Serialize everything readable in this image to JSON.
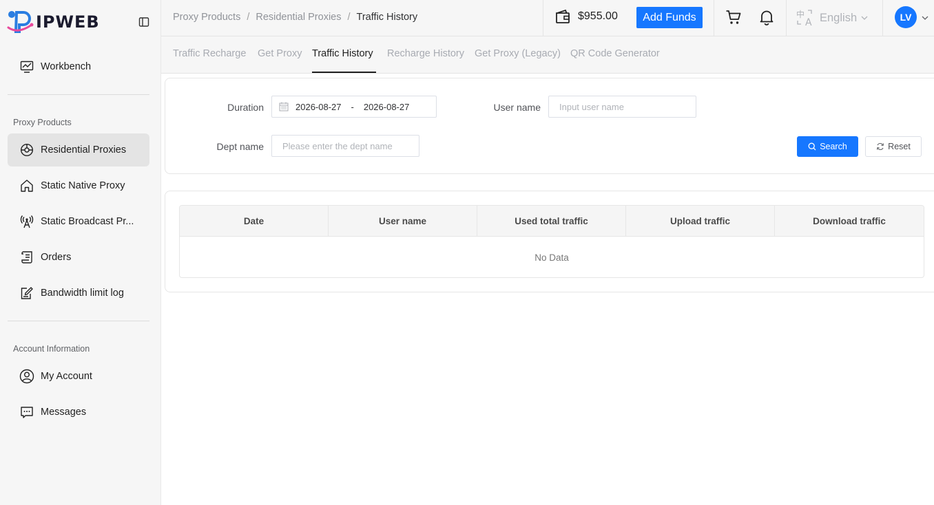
{
  "brand": {
    "name": "IPWEB",
    "primary_color": "#1677ff"
  },
  "sidebar": {
    "workbench": {
      "label": "Workbench",
      "icon": "monitor-chart-icon"
    },
    "groups": [
      {
        "title": "Proxy Products",
        "items": [
          {
            "label": "Residential Proxies",
            "icon": "globe-icon",
            "active": true
          },
          {
            "label": "Static Native Proxy",
            "icon": "home-icon",
            "active": false
          },
          {
            "label": "Static Broadcast Pr...",
            "icon": "antenna-icon",
            "active": false
          },
          {
            "label": "Orders",
            "icon": "scroll-icon",
            "active": false
          },
          {
            "label": "Bandwidth limit log",
            "icon": "edit-note-icon",
            "active": false
          }
        ]
      },
      {
        "title": "Account Information",
        "items": [
          {
            "label": "My Account",
            "icon": "user-circle-icon",
            "active": false
          },
          {
            "label": "Messages",
            "icon": "chat-bubble-icon",
            "active": false
          }
        ]
      }
    ]
  },
  "header": {
    "breadcrumb": [
      "Proxy Products",
      "Residential Proxies",
      "Traffic History"
    ],
    "balance": "$955.00",
    "add_funds_label": "Add Funds",
    "language": "English",
    "avatar_initials": "LV"
  },
  "tabs": [
    {
      "label": "Traffic Recharge",
      "active": false
    },
    {
      "label": "Get Proxy",
      "active": false
    },
    {
      "label": "Traffic History",
      "active": true
    },
    {
      "label": "Recharge History",
      "active": false
    },
    {
      "label": "Get Proxy (Legacy)",
      "active": false
    },
    {
      "label": "QR Code Generator",
      "active": false
    }
  ],
  "filters": {
    "duration_label": "Duration",
    "date_start": "2026-08-27",
    "date_sep": "-",
    "date_end": "2026-08-27",
    "username_label": "User name",
    "username_placeholder": "Input user name",
    "dept_label": "Dept name",
    "dept_placeholder": "Please enter the dept name",
    "search_label": "Search",
    "reset_label": "Reset"
  },
  "table": {
    "columns": [
      "Date",
      "User name",
      "Used total traffic",
      "Upload traffic",
      "Download traffic"
    ],
    "empty_text": "No Data"
  }
}
